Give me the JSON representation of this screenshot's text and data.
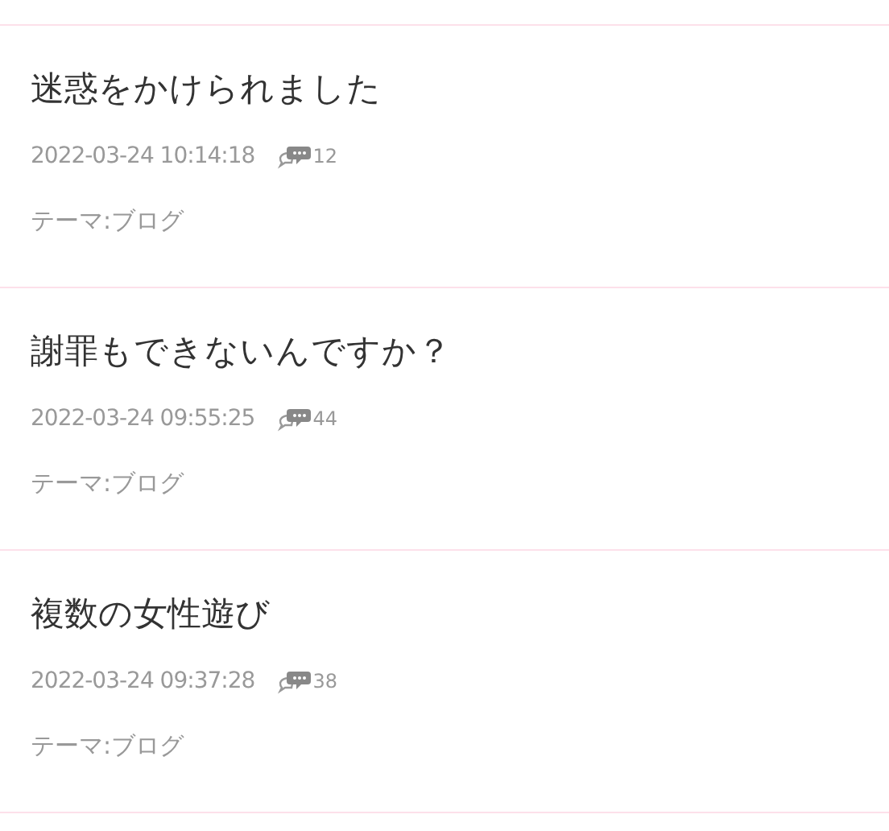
{
  "entries": [
    {
      "title": "迷惑をかけられました",
      "datetime": "2022-03-24 10:14:18",
      "comments": "12",
      "theme": "テーマ:ブログ"
    },
    {
      "title": "謝罪もできないんですか？",
      "datetime": "2022-03-24 09:55:25",
      "comments": "44",
      "theme": "テーマ:ブログ"
    },
    {
      "title": "複数の女性遊び",
      "datetime": "2022-03-24 09:37:28",
      "comments": "38",
      "theme": "テーマ:ブログ"
    }
  ]
}
